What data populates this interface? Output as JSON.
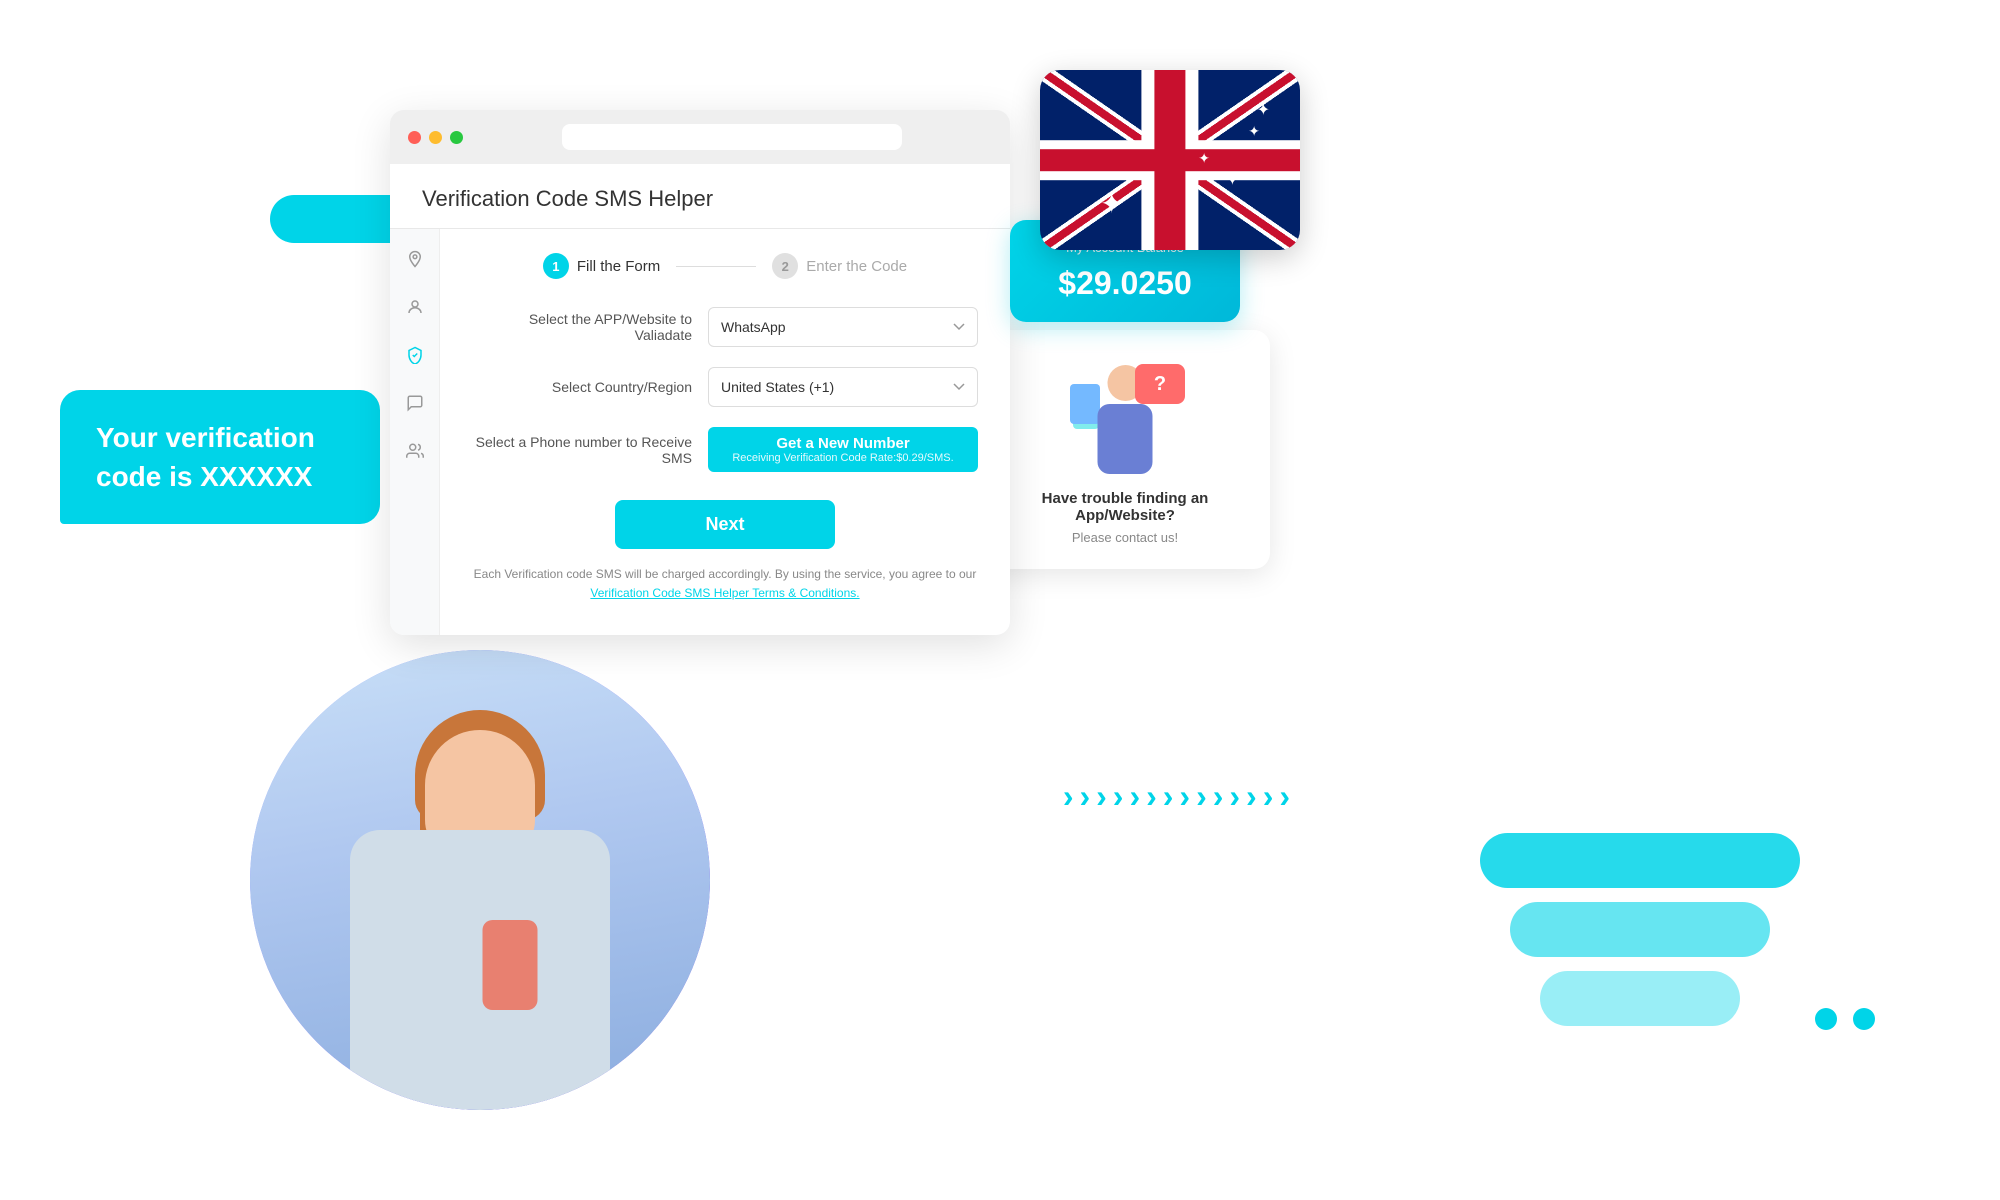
{
  "window": {
    "title": "Verification Code SMS Helper",
    "step1_label": "Fill the Form",
    "step2_label": "Enter the Code",
    "step1_number": "1",
    "step2_number": "2",
    "form": {
      "app_label": "Select the APP/Website to Valiadate",
      "app_value": "WhatsApp",
      "country_label": "Select Country/Region",
      "country_value": "United States (+1)",
      "phone_label": "Select a Phone number to Receive SMS",
      "get_number_label": "Get a New Number",
      "get_number_sub": "Receiving Verification Code Rate:$0.29/SMS.",
      "next_label": "Next",
      "terms_text": "Each Verification code SMS will be charged accordingly. By using the service, you agree to our",
      "terms_link": "Verification Code SMS Helper Terms & Conditions."
    }
  },
  "account": {
    "label": "My Account Balance",
    "balance": "$29.0250"
  },
  "help": {
    "title": "Have trouble finding an App/Website?",
    "subtitle": "Please contact us!"
  },
  "chat_bubble": {
    "text": "Your verification code is XXXXXX"
  },
  "chevrons": "»»»»»»»»»»»»",
  "sidebar": {
    "icons": [
      {
        "name": "location-icon",
        "symbol": "📍",
        "active": false
      },
      {
        "name": "user-icon",
        "symbol": "👤",
        "active": false
      },
      {
        "name": "shield-icon",
        "symbol": "🛡",
        "active": true
      },
      {
        "name": "message-icon",
        "symbol": "💬",
        "active": false
      },
      {
        "name": "contact-icon",
        "symbol": "👥",
        "active": false
      }
    ]
  }
}
